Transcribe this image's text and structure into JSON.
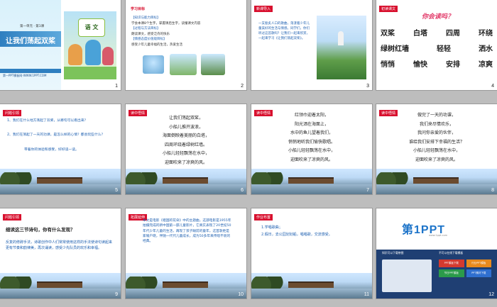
{
  "slides": [
    {
      "num": "1",
      "unit": "第一单元 · 第1课",
      "title": "让我们荡起双桨",
      "book": "语 文",
      "footer": "第一PPT模板网-WWW.1PPT.COM"
    },
    {
      "num": "2",
      "tag": "学习目标",
      "lines": [
        "【知识与能力目标】",
        "学会本课8个生字，掌握课后生字，读懂课文内容",
        "【过程与方法目标】",
        "朗读课文，感受泛舟的快乐",
        "【情感态度价值观目标】",
        "感受少年儿童幸福的生活，热爱生活"
      ]
    },
    {
      "num": "3",
      "tag": "新课导入",
      "text": "一支脍炙人口的歌曲，荡漾着少年儿童美好的生活与情感。同学们，你们听过这首歌吗？让我们一起来欣赏，一起来学习《让我们荡起双桨》。"
    },
    {
      "num": "4",
      "tag": "初读课文",
      "title": "你会读吗？",
      "row1": [
        "双桨",
        "白塔",
        "四周",
        "环绕"
      ],
      "row2": [
        "绿树红墙",
        "轻轻",
        "洒水"
      ],
      "row3": [
        "悄悄",
        "愉快",
        "安排",
        "凉爽"
      ]
    },
    {
      "num": "5",
      "tag": "问题引领",
      "q1": "1、我们在什么地方荡起了双桨，从哪句可以看出来？",
      "q2": "2、我们在荡起了一天的功课，是怎么样的心情？都会玩些什么？",
      "q3": "带着你的体验和感受，好好读一读。"
    },
    {
      "num": "6",
      "tag": "读中悟情",
      "lines": [
        "让我们荡起双桨，",
        "小船儿推开波浪，",
        "海面倒映着美丽的白塔，",
        "四周环绕着绿树红墙。",
        "小船儿轻轻飘荡在水中，",
        "迎面吹来了凉爽的风。"
      ]
    },
    {
      "num": "7",
      "tag": "读中悟情",
      "lines": [
        "红领巾迎着太阳，",
        "阳光洒在海面上，",
        "水中的鱼儿望着我们，",
        "悄悄地听我们愉快歌唱。",
        "小船儿轻轻飘荡在水中，",
        "迎面吹来了凉爽的风。"
      ]
    },
    {
      "num": "8",
      "tag": "读中悟情",
      "lines": [
        "做完了一天的功课，",
        "我们来尽情欢乐，",
        "我问你亲爱的伙伴，",
        "谁给我们安排下幸福的生活？",
        "小船儿轻轻飘荡在水中，",
        "迎面吹来了凉爽的风。"
      ]
    },
    {
      "num": "9",
      "tag": "问题引领",
      "head": "细读这三节诗句，你有什么发现？",
      "body": "反复的修辞手法，诗歌创作中人们常常使用这样的手法使诗句读起来更有节奏和韵律美，再次诵读，感受少先队员的欢乐和幸福。"
    },
    {
      "num": "10",
      "tag": "拓展延伸",
      "body": "本文是电影《祖国的花朵》中的主题曲，这部电影是1955年拍摄完成的新中国第一部儿童影片，它真实表现了20世纪50年代少年儿童的生活，再现了孩子眼前的童年，这首歌更是家喻户晓，伴随一代代儿童成长，成为50多年来传唱不衰的经典。"
    },
    {
      "num": "11",
      "tag": "作业布置",
      "lines": [
        "1.学唱歌曲；",
        "2.假日，去公园划划船，唱唱歌，交流感受。"
      ]
    },
    {
      "num": "12",
      "brand": "第1PPT",
      "site": "www.1ppt.com",
      "b1": "PPT模板下载",
      "b2": "行业PPT模板",
      "b3": "节日PPT模板",
      "b4": "PPT素材下载",
      "c1": "知识可以下载带图",
      "c2": "不可以在线下载模板"
    }
  ]
}
